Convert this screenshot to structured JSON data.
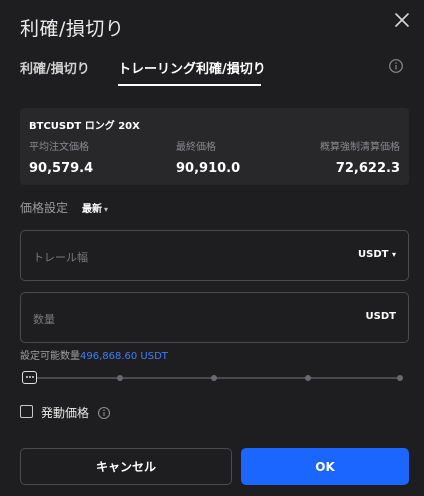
{
  "dialog": {
    "title": "利確/損切り"
  },
  "tabs": [
    {
      "label": "利確/損切り",
      "active": false
    },
    {
      "label": "トレーリング利確/損切り",
      "active": true
    }
  ],
  "position": {
    "symbol_line": "BTCUSDT ロング 20X",
    "avg_entry_label": "平均注文価格",
    "avg_entry_value": "90,579.4",
    "last_label": "最終価格",
    "last_value": "90,910.0",
    "liq_label": "概算強制清算価格",
    "liq_value": "72,622.3"
  },
  "price_setting": {
    "label": "価格設定",
    "type": "最新",
    "caret": "▾"
  },
  "trail_field": {
    "placeholder": "トレール幅",
    "unit": "USDT",
    "unit_caret": "▾"
  },
  "qty_field": {
    "placeholder": "数量",
    "unit": "USDT"
  },
  "available": {
    "label": "設定可能数量",
    "amount": "496,868.60 USDT"
  },
  "slider": {
    "value_percent": 0,
    "steps": 5
  },
  "trigger": {
    "label": "発動価格",
    "checked": false
  },
  "buttons": {
    "cancel": "キャンセル",
    "ok": "OK"
  },
  "colors": {
    "accent": "#1a66ff",
    "link": "#3d7eff",
    "background": "#1e1e20",
    "card": "#28282b"
  },
  "icons": {
    "close": "close-icon",
    "info": "info-icon"
  }
}
